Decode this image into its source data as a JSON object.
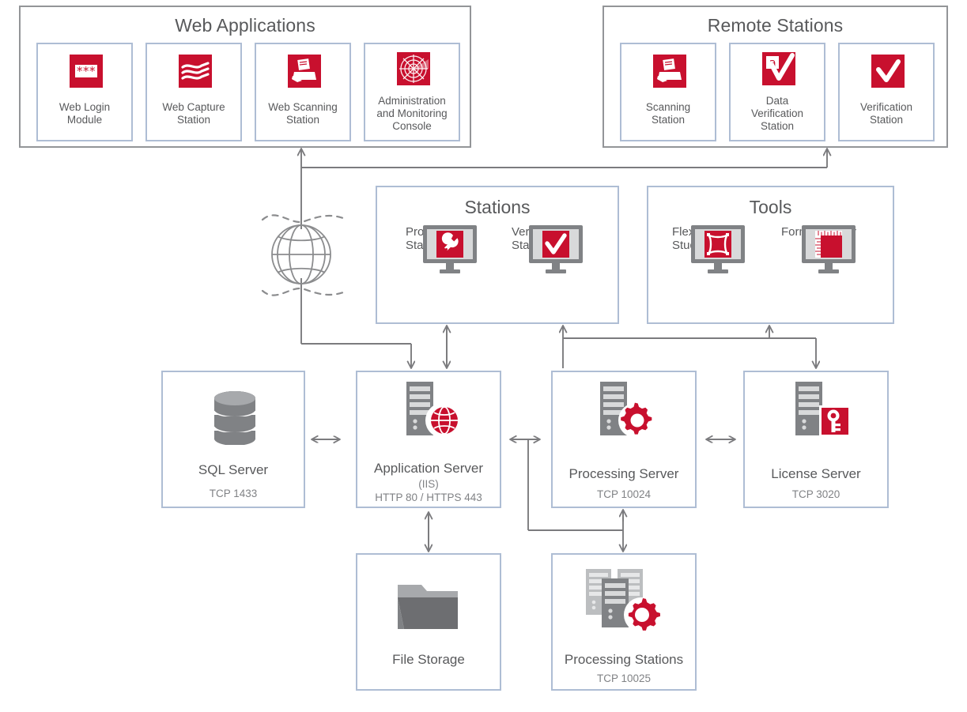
{
  "diagram": {
    "title_web": "Web Applications",
    "title_remote": "Remote Stations",
    "title_stations": "Stations",
    "title_tools": "Tools",
    "colors": {
      "brand_red": "#c8102e",
      "panel_border_blue": "#aebdd4",
      "group_border_gray": "#939598",
      "text_gray": "#58595b",
      "sub_text_gray": "#808285",
      "icon_gray": "#808285",
      "connector_gray": "#7b7b7e"
    }
  },
  "web_applications": {
    "title": "Web Applications",
    "items": [
      {
        "icon": "web-login-module-icon",
        "line1": "Web Login",
        "line2": "Module"
      },
      {
        "icon": "web-capture-station-icon",
        "line1": "Web Capture",
        "line2": "Station"
      },
      {
        "icon": "web-scanning-station-icon",
        "line1": "Web Scanning",
        "line2": "Station"
      },
      {
        "icon": "administration-monitoring-console-icon",
        "line1": "Administration",
        "line2": "and Monitoring",
        "line3": "Console"
      }
    ]
  },
  "remote_stations": {
    "title": "Remote Stations",
    "items": [
      {
        "icon": "scanning-station-icon",
        "line1": "Scanning",
        "line2": "Station"
      },
      {
        "icon": "data-verification-station-icon",
        "line1": "Data",
        "line2": "Verification",
        "line3": "Station"
      },
      {
        "icon": "verification-station-icon",
        "line1": "Verification",
        "line2": "Station"
      }
    ]
  },
  "stations": {
    "title": "Stations",
    "items": [
      {
        "icon": "project-setup-station-icon",
        "line1": "Project Setup",
        "line2": "Station"
      },
      {
        "icon": "verification-station-icon",
        "line1": "Verification",
        "line2": "Station"
      }
    ]
  },
  "tools": {
    "title": "Tools",
    "items": [
      {
        "icon": "flexilayout-studio-icon",
        "line1": "FlexiLayout®",
        "line2": "Studio"
      },
      {
        "icon": "formdesigner-icon",
        "line1": "FormDesigner",
        "line2": ""
      }
    ]
  },
  "servers": [
    {
      "key": "sql",
      "icon": "database-icon",
      "name": "SQL Server",
      "sub1": "",
      "sub2": "TCP 1433"
    },
    {
      "key": "app",
      "icon": "application-server-icon",
      "name": "Application Server",
      "sub1": "(IIS)",
      "sub2": "HTTP 80 / HTTPS 443"
    },
    {
      "key": "processing",
      "icon": "processing-server-icon",
      "name": "Processing Server",
      "sub1": "",
      "sub2": "TCP 10024"
    },
    {
      "key": "license",
      "icon": "license-server-icon",
      "name": "License Server",
      "sub1": "",
      "sub2": "TCP 3020"
    }
  ],
  "storage": [
    {
      "key": "file",
      "icon": "folder-icon",
      "name": "File Storage",
      "sub2": ""
    },
    {
      "key": "procstat",
      "icon": "processing-stations-icon",
      "name": "Processing Stations",
      "sub2": "TCP 10025"
    }
  ],
  "network": {
    "icon": "globe-icon",
    "label": ""
  }
}
